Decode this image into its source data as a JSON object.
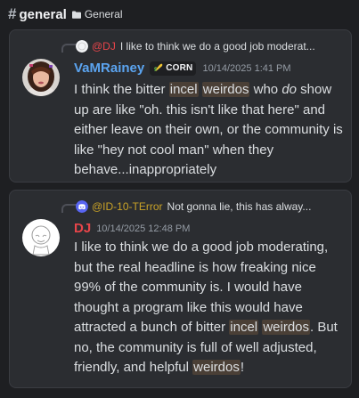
{
  "header": {
    "hash_glyph": "#",
    "channel_name": "general",
    "category_icon": "folder-icon",
    "category_name": "General"
  },
  "colors": {
    "background": "#1e1f22",
    "card": "#2b2d31",
    "vamrainey": "#5ba4f0",
    "dj": "#e8454a",
    "id10terror": "#c9a227",
    "highlight": "#4a3f36",
    "discord_blurple": "#5865f2"
  },
  "messages": [
    {
      "reply": {
        "avatar_icon": "dj-mini-avatar",
        "author": "@DJ",
        "preview": "I like to think we do a good job moderat..."
      },
      "author": "VaMRainey",
      "role": {
        "icon": "corn-icon",
        "label": "CORN"
      },
      "timestamp": "10/14/2025 1:41 PM",
      "segments": [
        "I think the bitter ",
        "incel",
        " ",
        "weirdos",
        " who ",
        "do",
        " show up are like \"oh. this isn't like that here\" and either leave on their own, or the community is like \"hey not cool man\" when they behave...inappropriately"
      ]
    },
    {
      "reply": {
        "avatar_icon": "discord-mini-avatar",
        "author": "@ID-10-TError",
        "preview": "Not gonna lie, this has alway..."
      },
      "author": "DJ",
      "timestamp": "10/14/2025 12:48 PM",
      "segments": [
        "I like to think we do a good job moderating, but the real headline is how freaking nice 99% of the community is.  I would have thought a program like this would have attracted a bunch of bitter ",
        "incel",
        " ",
        "weirdos",
        ". But no, the community is full of well adjusted, friendly, and helpful ",
        "weirdos",
        "!"
      ]
    }
  ]
}
